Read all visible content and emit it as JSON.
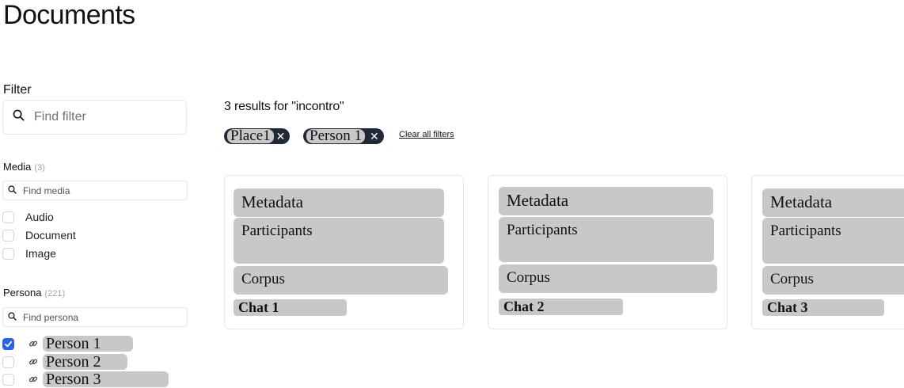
{
  "page": {
    "title": "Documents"
  },
  "filter": {
    "heading": "Filter",
    "search_placeholder": "Find filter"
  },
  "media": {
    "title": "Media",
    "count": "(3)",
    "search_placeholder": "Find media",
    "options": [
      {
        "label": "Audio",
        "checked": false
      },
      {
        "label": "Document",
        "checked": false
      },
      {
        "label": "Image",
        "checked": false
      }
    ]
  },
  "persona": {
    "title": "Persona",
    "count": "(221)",
    "search_placeholder": "Find persona",
    "options": [
      {
        "label": "Person 1",
        "checked": true,
        "icon": "link-icon"
      },
      {
        "label": "Person 2",
        "checked": false,
        "icon": "link-icon"
      },
      {
        "label": "Person 3",
        "checked": false,
        "icon": "link-icon"
      }
    ]
  },
  "results": {
    "heading": "3 results for \"incontro\"",
    "active_filters": [
      {
        "label": "Place1",
        "remove_icon": "close-icon"
      },
      {
        "label": "Person 1",
        "remove_icon": "close-icon"
      }
    ],
    "clear_label": "Clear all filters",
    "cards": [
      {
        "metadata": "Metadata",
        "participants": "Participants",
        "corpus": "Corpus",
        "chat": "Chat 1"
      },
      {
        "metadata": "Metadata",
        "participants": "Participants",
        "corpus": "Corpus",
        "chat": "Chat 2"
      },
      {
        "metadata": "Metadata",
        "participants": "Participants",
        "corpus": "Corpus",
        "chat": "Chat 3"
      }
    ]
  },
  "colors": {
    "accent": "#2563eb",
    "chip_bg": "#1f2937",
    "placeholder_box": "#c8c8c8",
    "border": "#e5e7eb"
  }
}
